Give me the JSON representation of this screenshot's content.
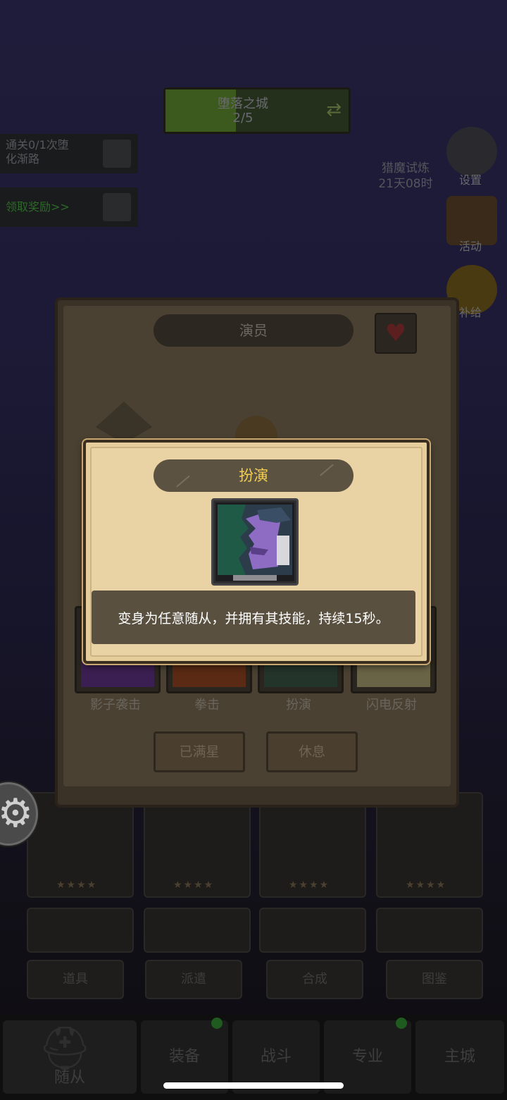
{
  "background": {
    "map": {
      "name": "堕落之城",
      "progress": "2/5"
    },
    "quests": [
      {
        "line1": "通关0/1次堕",
        "line2": "化渐路"
      },
      {
        "line1": "领取奖励>>"
      }
    ],
    "side_menu": [
      {
        "label": "设置",
        "icon": "gear-icon"
      },
      {
        "label": "活动",
        "icon": "chest-icon"
      },
      {
        "label": "补给",
        "icon": "coin-icon"
      }
    ],
    "trial": {
      "title": "猎魔试炼",
      "timer": "21天08时"
    },
    "tabs": [
      "道具",
      "派遣",
      "合成",
      "图鉴"
    ],
    "bottom_nav": [
      {
        "label": "随从",
        "active": true,
        "badge": false
      },
      {
        "label": "装备",
        "badge": true
      },
      {
        "label": "战斗",
        "badge": false
      },
      {
        "label": "专业",
        "badge": true
      },
      {
        "label": "主城",
        "badge": false
      }
    ]
  },
  "character_panel": {
    "title": "演员",
    "skills": [
      {
        "name": "影子袭击",
        "color": "#5b2a7a"
      },
      {
        "name": "拳击",
        "color": "#8a3a1a"
      },
      {
        "name": "扮演",
        "color": "#2f4a3a"
      },
      {
        "name": "闪电反射",
        "color": "#d8c888"
      }
    ],
    "buttons": {
      "max_star": "已满星",
      "rest": "休息"
    }
  },
  "skill_popup": {
    "title": "扮演",
    "description": "变身为任意随从，并拥有其技能，持续15秒。",
    "colors": {
      "title_text": "#f4cf52",
      "paper": "#e9d2a3",
      "desc_bg": "#5a5040"
    }
  }
}
